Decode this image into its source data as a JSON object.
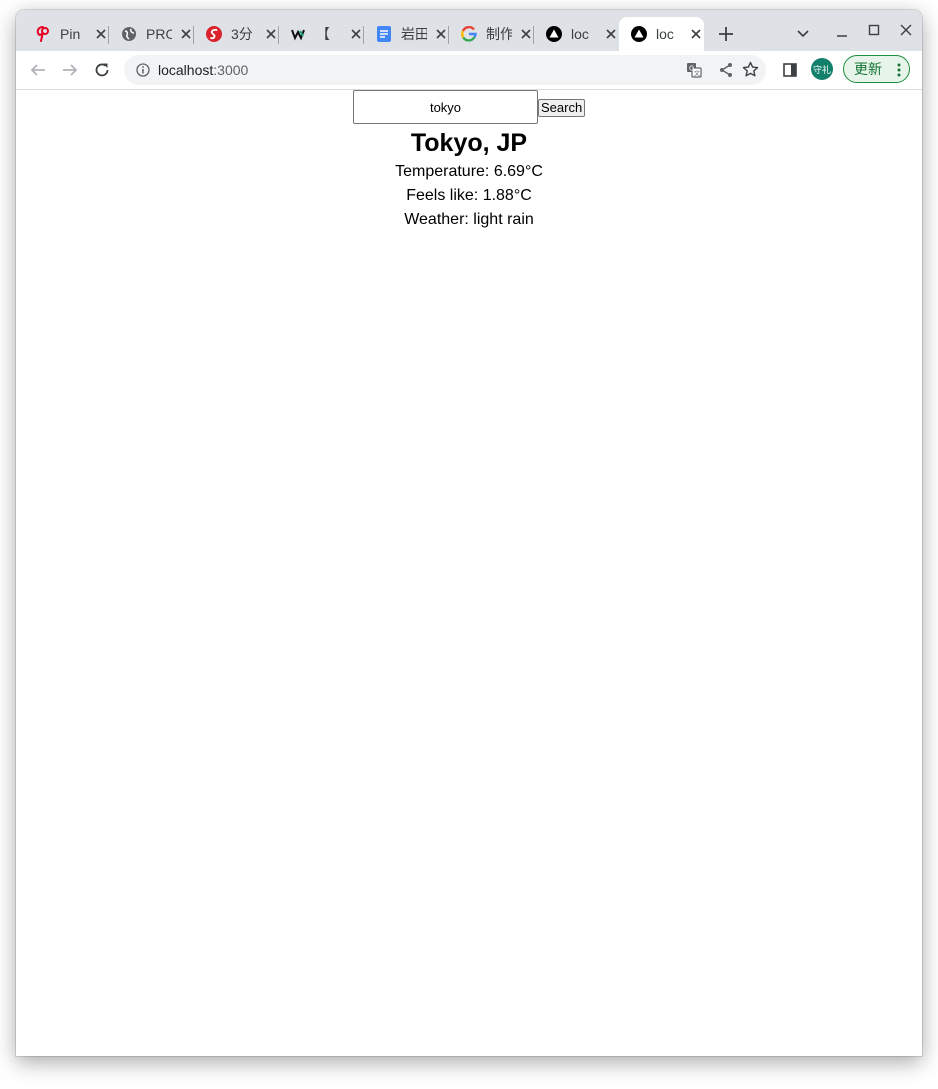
{
  "browser": {
    "tabs": [
      {
        "title": "Pin",
        "icon": "pinterest-icon",
        "active": false
      },
      {
        "title": "PRO",
        "icon": "globe-icon",
        "active": false
      },
      {
        "title": "3分",
        "icon": "red-swirl-icon",
        "active": false
      },
      {
        "title": "【",
        "icon": "w-logo-icon",
        "active": false
      },
      {
        "title": "岩田",
        "icon": "google-docs-icon",
        "active": false
      },
      {
        "title": "制作",
        "icon": "google-icon",
        "active": false
      },
      {
        "title": "loc",
        "icon": "nextjs-icon",
        "active": false
      },
      {
        "title": "loc",
        "icon": "nextjs-icon",
        "active": true
      }
    ],
    "url_host": "localhost",
    "url_port": ":3000",
    "profile_label": "守礼",
    "update_label": "更新"
  },
  "app": {
    "search_value": "tokyo",
    "search_button": "Search",
    "city": "Tokyo, JP",
    "temperature_label": "Temperature: ",
    "temperature_value": "6.69°C",
    "feels_label": "Feels like: ",
    "feels_value": "1.88°C",
    "weather_label": "Weather: ",
    "weather_value": "light rain"
  }
}
